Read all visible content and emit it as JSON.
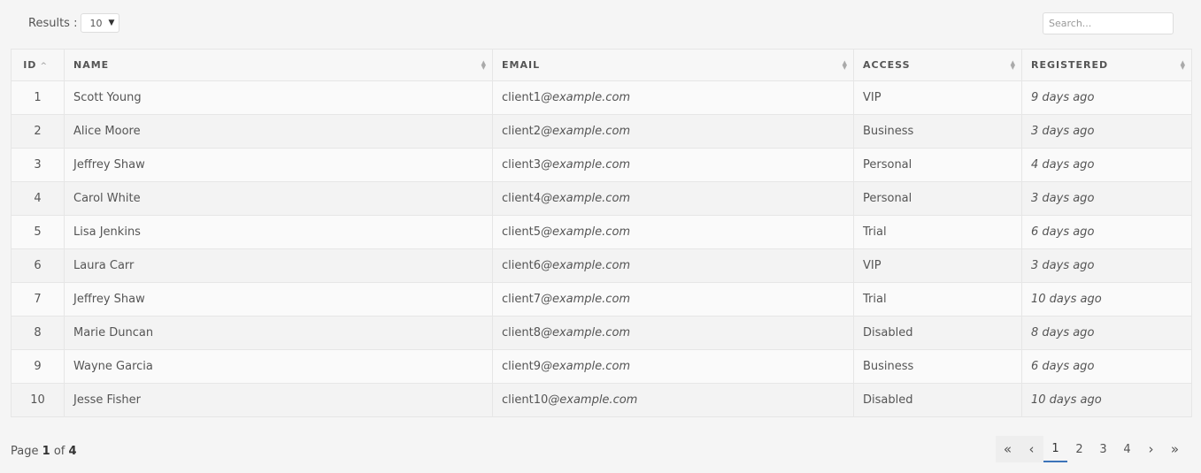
{
  "toolbar": {
    "results_label": "Results :",
    "results_value": "10",
    "search_placeholder": "Search..."
  },
  "table": {
    "columns": [
      "ID",
      "NAME",
      "EMAIL",
      "ACCESS",
      "REGISTERED"
    ],
    "rows": [
      {
        "id": "1",
        "name": "Scott Young",
        "email_user": "client1",
        "email_domain": "@example.com",
        "access": "VIP",
        "registered": "9 days ago"
      },
      {
        "id": "2",
        "name": "Alice Moore",
        "email_user": "client2",
        "email_domain": "@example.com",
        "access": "Business",
        "registered": "3 days ago"
      },
      {
        "id": "3",
        "name": "Jeffrey Shaw",
        "email_user": "client3",
        "email_domain": "@example.com",
        "access": "Personal",
        "registered": "4 days ago"
      },
      {
        "id": "4",
        "name": "Carol White",
        "email_user": "client4",
        "email_domain": "@example.com",
        "access": "Personal",
        "registered": "3 days ago"
      },
      {
        "id": "5",
        "name": "Lisa Jenkins",
        "email_user": "client5",
        "email_domain": "@example.com",
        "access": "Trial",
        "registered": "6 days ago"
      },
      {
        "id": "6",
        "name": "Laura Carr",
        "email_user": "client6",
        "email_domain": "@example.com",
        "access": "VIP",
        "registered": "3 days ago"
      },
      {
        "id": "7",
        "name": "Jeffrey Shaw",
        "email_user": "client7",
        "email_domain": "@example.com",
        "access": "Trial",
        "registered": "10 days ago"
      },
      {
        "id": "8",
        "name": "Marie Duncan",
        "email_user": "client8",
        "email_domain": "@example.com",
        "access": "Disabled",
        "registered": "8 days ago"
      },
      {
        "id": "9",
        "name": "Wayne Garcia",
        "email_user": "client9",
        "email_domain": "@example.com",
        "access": "Business",
        "registered": "6 days ago"
      },
      {
        "id": "10",
        "name": "Jesse Fisher",
        "email_user": "client10",
        "email_domain": "@example.com",
        "access": "Disabled",
        "registered": "10 days ago"
      }
    ]
  },
  "footer": {
    "page_word": "Page",
    "current_page": "1",
    "of_word": "of",
    "total_pages": "4"
  },
  "pagination": {
    "first": "«",
    "prev": "‹",
    "pages": [
      "1",
      "2",
      "3",
      "4"
    ],
    "next": "›",
    "last": "»"
  },
  "colors": {
    "active_page_underline": "#3c74b9"
  }
}
